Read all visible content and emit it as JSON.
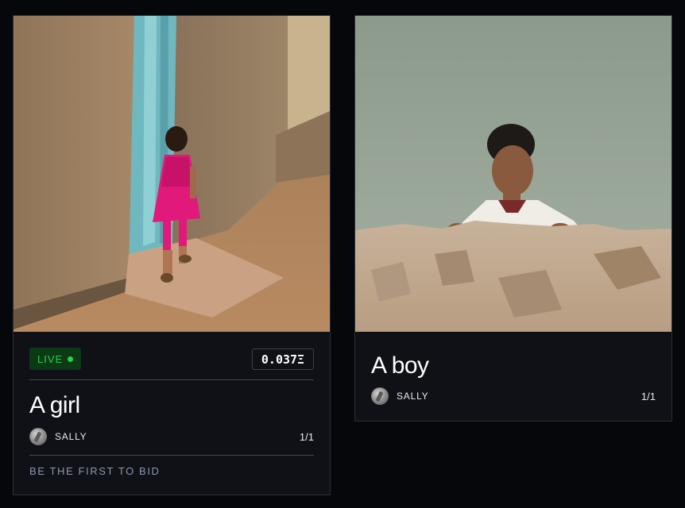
{
  "cards": [
    {
      "status": "LIVE",
      "price": "0.037Ξ",
      "title": "A girl",
      "owner": "SALLY",
      "edition": "1/1",
      "bid_text": "BE THE FIRST TO BID",
      "image_alt": "girl in pink dress walking in alley"
    },
    {
      "title": "A boy",
      "owner": "SALLY",
      "edition": "1/1",
      "image_alt": "boy looking over rocky wall by water"
    }
  ],
  "colors": {
    "background": "#05070b",
    "card": "#0f1116",
    "live_badge_bg": "#0b3a14",
    "live_green": "#2bd14a",
    "muted_text": "#8c96b0"
  }
}
